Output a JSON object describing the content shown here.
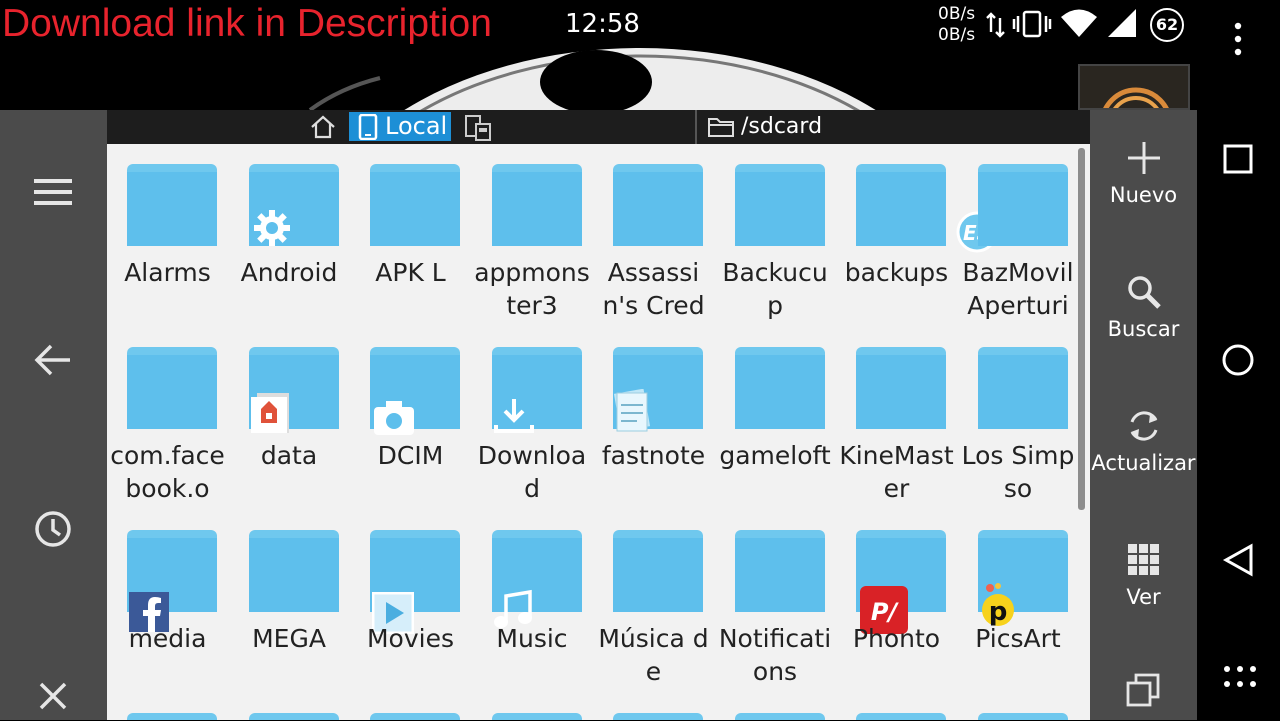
{
  "overlay": {
    "text": "Download link in Description"
  },
  "status": {
    "time": "12:58",
    "net_up": "0B/s",
    "net_down": "0B/s",
    "battery": "62"
  },
  "toolbar": {
    "local_label": "Local",
    "path": "/sdcard"
  },
  "files": [
    {
      "name": "Alarms",
      "badge": ""
    },
    {
      "name": "Android",
      "badge": "gear"
    },
    {
      "name": "APK L",
      "badge": ""
    },
    {
      "name": "appmonster3",
      "badge": ""
    },
    {
      "name": "Assassin's Cred",
      "badge": ""
    },
    {
      "name": "Backucup",
      "badge": ""
    },
    {
      "name": "backups",
      "badge": "es"
    },
    {
      "name": "BazMovilAperturi",
      "badge": ""
    },
    {
      "name": "com.facebook.o",
      "badge": ""
    },
    {
      "name": "data",
      "badge": "apk"
    },
    {
      "name": "DCIM",
      "badge": "camera"
    },
    {
      "name": "Download",
      "badge": "download"
    },
    {
      "name": "fastnote",
      "badge": "note"
    },
    {
      "name": "gameloft",
      "badge": ""
    },
    {
      "name": "KineMaster",
      "badge": ""
    },
    {
      "name": "Los Simpso",
      "badge": ""
    },
    {
      "name": "media",
      "badge": "facebook"
    },
    {
      "name": "MEGA",
      "badge": ""
    },
    {
      "name": "Movies",
      "badge": "play"
    },
    {
      "name": "Music",
      "badge": "music"
    },
    {
      "name": "Música de",
      "badge": ""
    },
    {
      "name": "Notifications",
      "badge": ""
    },
    {
      "name": "Phonto",
      "badge": "phonto"
    },
    {
      "name": "PicsArt",
      "badge": "picsart"
    }
  ],
  "actions": {
    "new": "Nuevo",
    "search": "Buscar",
    "refresh": "Actualizar",
    "view": "Ver"
  },
  "colors": {
    "folder": "#5ebfec",
    "accent": "#1d8fd6",
    "bar": "#4b4b4b",
    "overlay_text": "#e8232d"
  }
}
